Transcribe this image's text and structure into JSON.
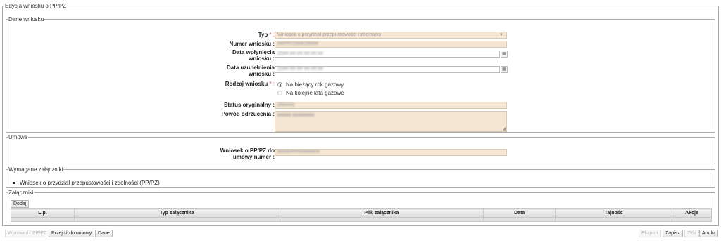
{
  "outer_legend": "Edycja wniosku o PP/PZ",
  "dane": {
    "legend": "Dane wniosku",
    "typ_label": "Typ",
    "typ_value": "Wniosek o przydział przepustowości i zdolności",
    "numer_label": "Numer wniosku :",
    "numer_value": "##/PP/20##/2####",
    "data_wplyniecia_label_1": "Data wpłynięcia",
    "data_wplyniecia_label_2": "wniosku :",
    "data_wplyniecia_value": "20##-##-## ##:##:##",
    "data_uzupelnienia_label_1": "Data uzupełnienia",
    "data_uzupelnienia_label_2": "wniosku :",
    "data_uzupelnienia_value": "20##-##-## ##:##:##",
    "rodzaj_label": "Rodzaj wniosku",
    "rodzaj_option_1": "Na bieżący rok gazowy",
    "rodzaj_option_2": "Na kolejne lata gazowe",
    "status_label": "Status oryginalny :",
    "status_value": "Złożony",
    "powod_label": "Powód odrzucenia :",
    "powod_value": "##### ########"
  },
  "umowa": {
    "legend": "Umowa",
    "label_1": "Wniosek o PP/PZ do",
    "label_2": "umowy numer :",
    "value": "##/##/PP##/####/#"
  },
  "wymagane": {
    "legend": "Wymagane załączniki",
    "item": "Wniosek o przydział przepustowości i zdolności (PP/PZ)"
  },
  "zalaczniki": {
    "legend": "Załączniki",
    "add_button": "Dodaj",
    "columns": [
      "L.p.",
      "Typ załącznika",
      "Plik załącznika",
      "Data",
      "Tajność",
      "Akcje"
    ]
  },
  "footer": {
    "btn_wprowadz": "Wprowadź PP/PZ",
    "btn_przejdz": "Przejdź do umowy",
    "btn_dane": "Dane",
    "btn_eksport": "Eksport",
    "btn_zapisz": "Zapisz",
    "btn_zloz": "Złóż",
    "btn_anuluj": "Anuluj"
  },
  "colors": {
    "readonly_field": "#f5e6d3",
    "required_marker": "#d9534f",
    "border": "#a8a8a8"
  }
}
